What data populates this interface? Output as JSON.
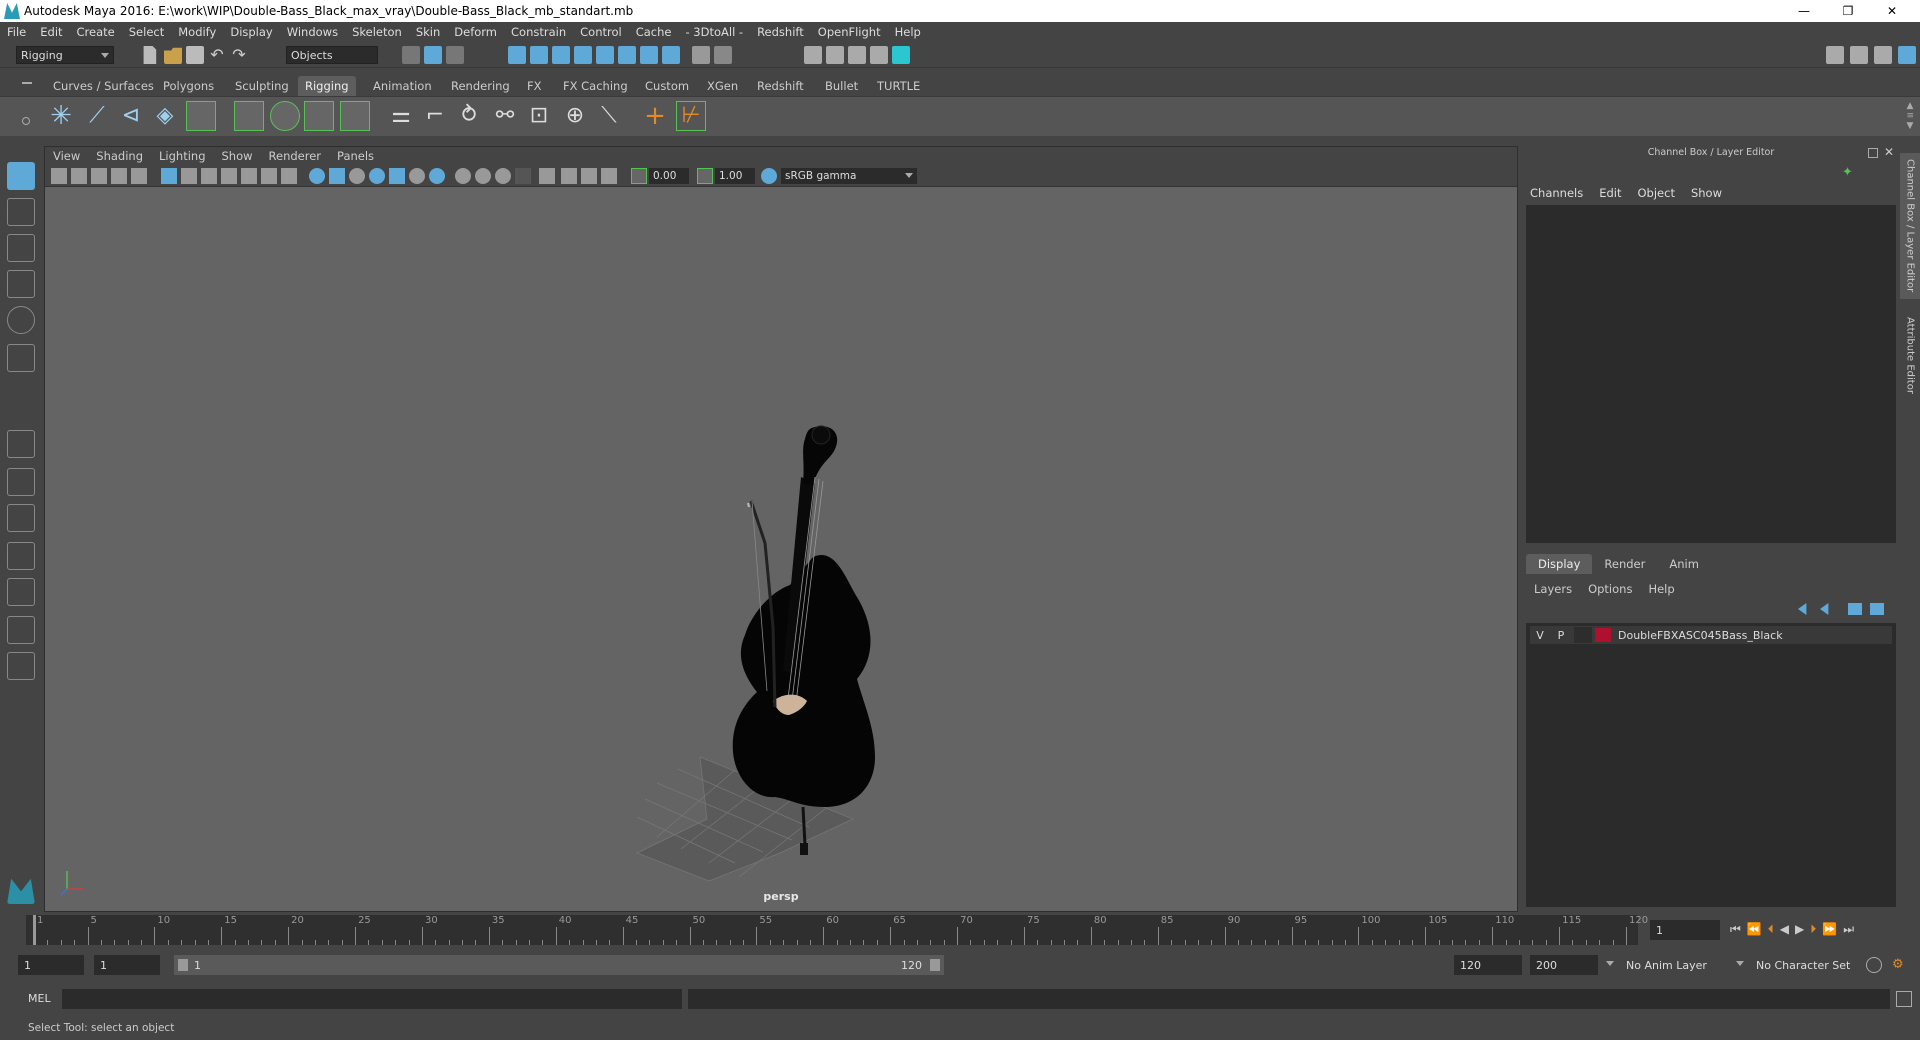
{
  "window": {
    "title": "Autodesk Maya 2016: E:\\work\\WIP\\Double-Bass_Black_max_vray\\Double-Bass_Black_mb_standart.mb",
    "minimize": "—",
    "restore": "❐",
    "close": "✕"
  },
  "menubar": [
    "File",
    "Edit",
    "Create",
    "Select",
    "Modify",
    "Display",
    "Windows",
    "Skeleton",
    "Skin",
    "Deform",
    "Constrain",
    "Control",
    "Cache",
    "- 3DtoAll -",
    "Redshift",
    "OpenFlight",
    "Help"
  ],
  "toolbar": {
    "mode_select": "Rigging",
    "objects_field": "Objects"
  },
  "shelf_tabs": [
    "Curves / Surfaces",
    "Polygons",
    "Sculpting",
    "Rigging",
    "Animation",
    "Rendering",
    "FX",
    "FX Caching",
    "Custom",
    "XGen",
    "Redshift",
    "Bullet",
    "TURTLE"
  ],
  "shelf_active": "Rigging",
  "viewport": {
    "menu": [
      "View",
      "Shading",
      "Lighting",
      "Show",
      "Renderer",
      "Panels"
    ],
    "exposure": "0.00",
    "gamma": "1.00",
    "color_space": "sRGB gamma",
    "camera_label": "persp"
  },
  "right_panel": {
    "title": "Channel Box / Layer Editor",
    "menu": [
      "Channels",
      "Edit",
      "Object",
      "Show"
    ],
    "layer_tabs": [
      "Display",
      "Render",
      "Anim"
    ],
    "layer_tab_active": "Display",
    "layer_menu": [
      "Layers",
      "Options",
      "Help"
    ],
    "layer": {
      "v": "V",
      "p": "P",
      "name": "DoubleFBXASC045Bass_Black",
      "color": "#b0102e"
    },
    "side_tabs": [
      "Channel Box / Layer Editor",
      "Attribute Editor"
    ]
  },
  "timeline": {
    "ticks": [
      1,
      5,
      10,
      15,
      20,
      25,
      30,
      35,
      40,
      45,
      50,
      55,
      60,
      65,
      70,
      75,
      80,
      85,
      90,
      95,
      100,
      105,
      110,
      115,
      120
    ],
    "current_frame": "1"
  },
  "range": {
    "start": "1",
    "playback_start": "1",
    "slider_start": "1",
    "slider_end": "120",
    "playback_end": "120",
    "end": "200",
    "anim_layer": "No Anim Layer",
    "character_set": "No Character Set"
  },
  "command": {
    "label": "MEL"
  },
  "status": "Select Tool: select an object",
  "colors": {
    "accent_blue": "#5ea9d8",
    "accent_green": "#56c255",
    "accent_orange": "#e08a2a"
  }
}
